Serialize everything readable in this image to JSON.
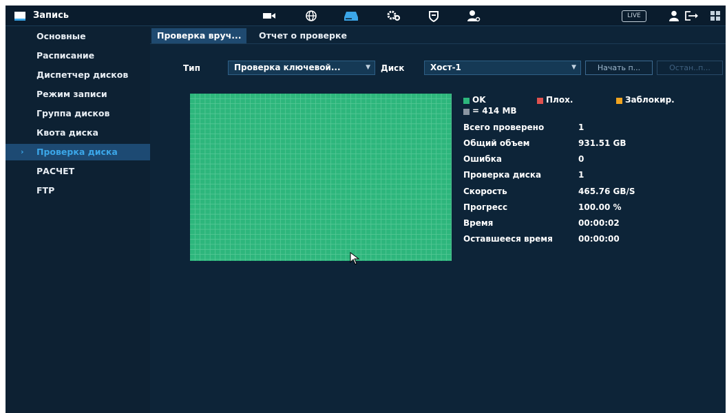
{
  "app": {
    "title": "Запись",
    "live_label": "LIVE"
  },
  "topbar": {
    "icons": [
      "camera-icon",
      "network-globe-icon",
      "storage-icon",
      "settings-gears-icon",
      "shield-icon",
      "account-settings-icon",
      "user-icon",
      "logout-icon",
      "menu-grid-icon"
    ],
    "active_icon": "storage-icon",
    "accent_color": "#3ba6e8"
  },
  "sidebar": {
    "items": [
      {
        "label": "Основные",
        "active": false
      },
      {
        "label": "Расписание",
        "active": false
      },
      {
        "label": "Диспетчер дисков",
        "active": false
      },
      {
        "label": "Режим записи",
        "active": false
      },
      {
        "label": "Группа дисков",
        "active": false
      },
      {
        "label": "Квота диска",
        "active": false
      },
      {
        "label": "Проверка диска",
        "active": true
      },
      {
        "label": "РАСЧЕТ",
        "active": false
      },
      {
        "label": "FTP",
        "active": false
      }
    ]
  },
  "tabs": [
    {
      "label": "Проверка вруч...",
      "active": true
    },
    {
      "label": "Отчет о проверке",
      "active": false
    }
  ],
  "form": {
    "type_label": "Тип",
    "type_value": "Проверка ключевой...",
    "disk_label": "Диск",
    "disk_value": "Хост-1",
    "start_button": "Начать п...",
    "stop_button": "Остан..п..."
  },
  "legend": {
    "ok": "OK",
    "bad": "Плох.",
    "blocked": "Заблокир.",
    "unit": "= 414 MB",
    "ok_color": "#2db67c",
    "bad_color": "#e0524f",
    "blocked_color": "#f0a420",
    "unit_color": "#8a96a2"
  },
  "stats": [
    {
      "label": "Всего проверено",
      "value": "1"
    },
    {
      "label": "Общий объем",
      "value": "931.51 GB"
    },
    {
      "label": "Ошибка",
      "value": "0"
    },
    {
      "label": "Проверка диска",
      "value": "1"
    },
    {
      "label": "Скорость",
      "value": "465.76 GB/S"
    },
    {
      "label": "Прогресс",
      "value": "100.00 %"
    },
    {
      "label": "Время",
      "value": "00:00:02"
    },
    {
      "label": "Оставшееся время",
      "value": "00:00:00"
    }
  ],
  "grid": {
    "status": "ok",
    "fill_color": "#2db67c"
  }
}
